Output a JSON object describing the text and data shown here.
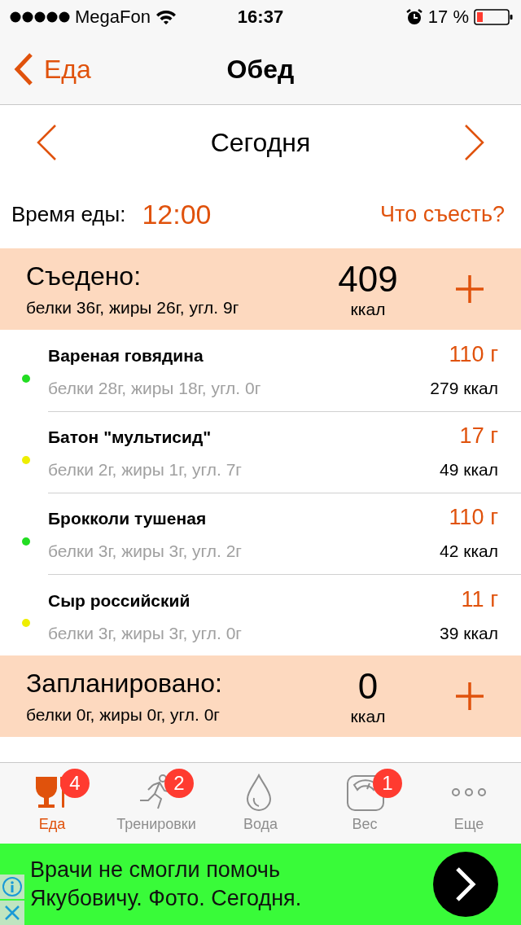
{
  "status_bar": {
    "carrier": "MegaFon",
    "time": "16:37",
    "battery": "17 %"
  },
  "nav": {
    "back": "Еда",
    "title": "Обед"
  },
  "date": {
    "label": "Сегодня"
  },
  "meal_time": {
    "label": "Время еды:",
    "value": "12:00",
    "suggest": "Что съесть?"
  },
  "eaten": {
    "title": "Съедено:",
    "macros": "белки 36г, жиры 26г, угл. 9г",
    "kcal": "409",
    "unit": "ккал"
  },
  "items": [
    {
      "name": "Вареная говядина",
      "grams": "110 г",
      "macros": "белки 28г, жиры 18г, угл. 0г",
      "kcal": "279 ккал",
      "color": "#22dd22"
    },
    {
      "name": "Батон \"мультисид\"",
      "grams": "17 г",
      "macros": "белки 2г, жиры 1г, угл. 7г",
      "kcal": "49 ккал",
      "color": "#eeee00"
    },
    {
      "name": "Брокколи тушеная",
      "grams": "110 г",
      "macros": "белки 3г, жиры 3г, угл. 2г",
      "kcal": "42 ккал",
      "color": "#22dd22"
    },
    {
      "name": "Сыр российский",
      "grams": "11 г",
      "macros": "белки 3г, жиры 3г, угл. 0г",
      "kcal": "39 ккал",
      "color": "#eeee00"
    }
  ],
  "planned": {
    "title": "Запланировано:",
    "macros": "белки 0г, жиры 0г, угл. 0г",
    "kcal": "0",
    "unit": "ккал"
  },
  "tabs": [
    {
      "kind": "food",
      "label": "Еда",
      "badge": "4",
      "selected": true
    },
    {
      "kind": "workout",
      "label": "Тренировки",
      "badge": "2",
      "selected": false
    },
    {
      "kind": "water",
      "label": "Вода",
      "selected": false
    },
    {
      "kind": "weight",
      "label": "Вес",
      "badge": "1",
      "selected": false
    },
    {
      "kind": "more",
      "label": "Еще",
      "selected": false
    }
  ],
  "ad": {
    "text": "Врачи не смогли помочь Якубовичу. Фото. Сегодня."
  }
}
